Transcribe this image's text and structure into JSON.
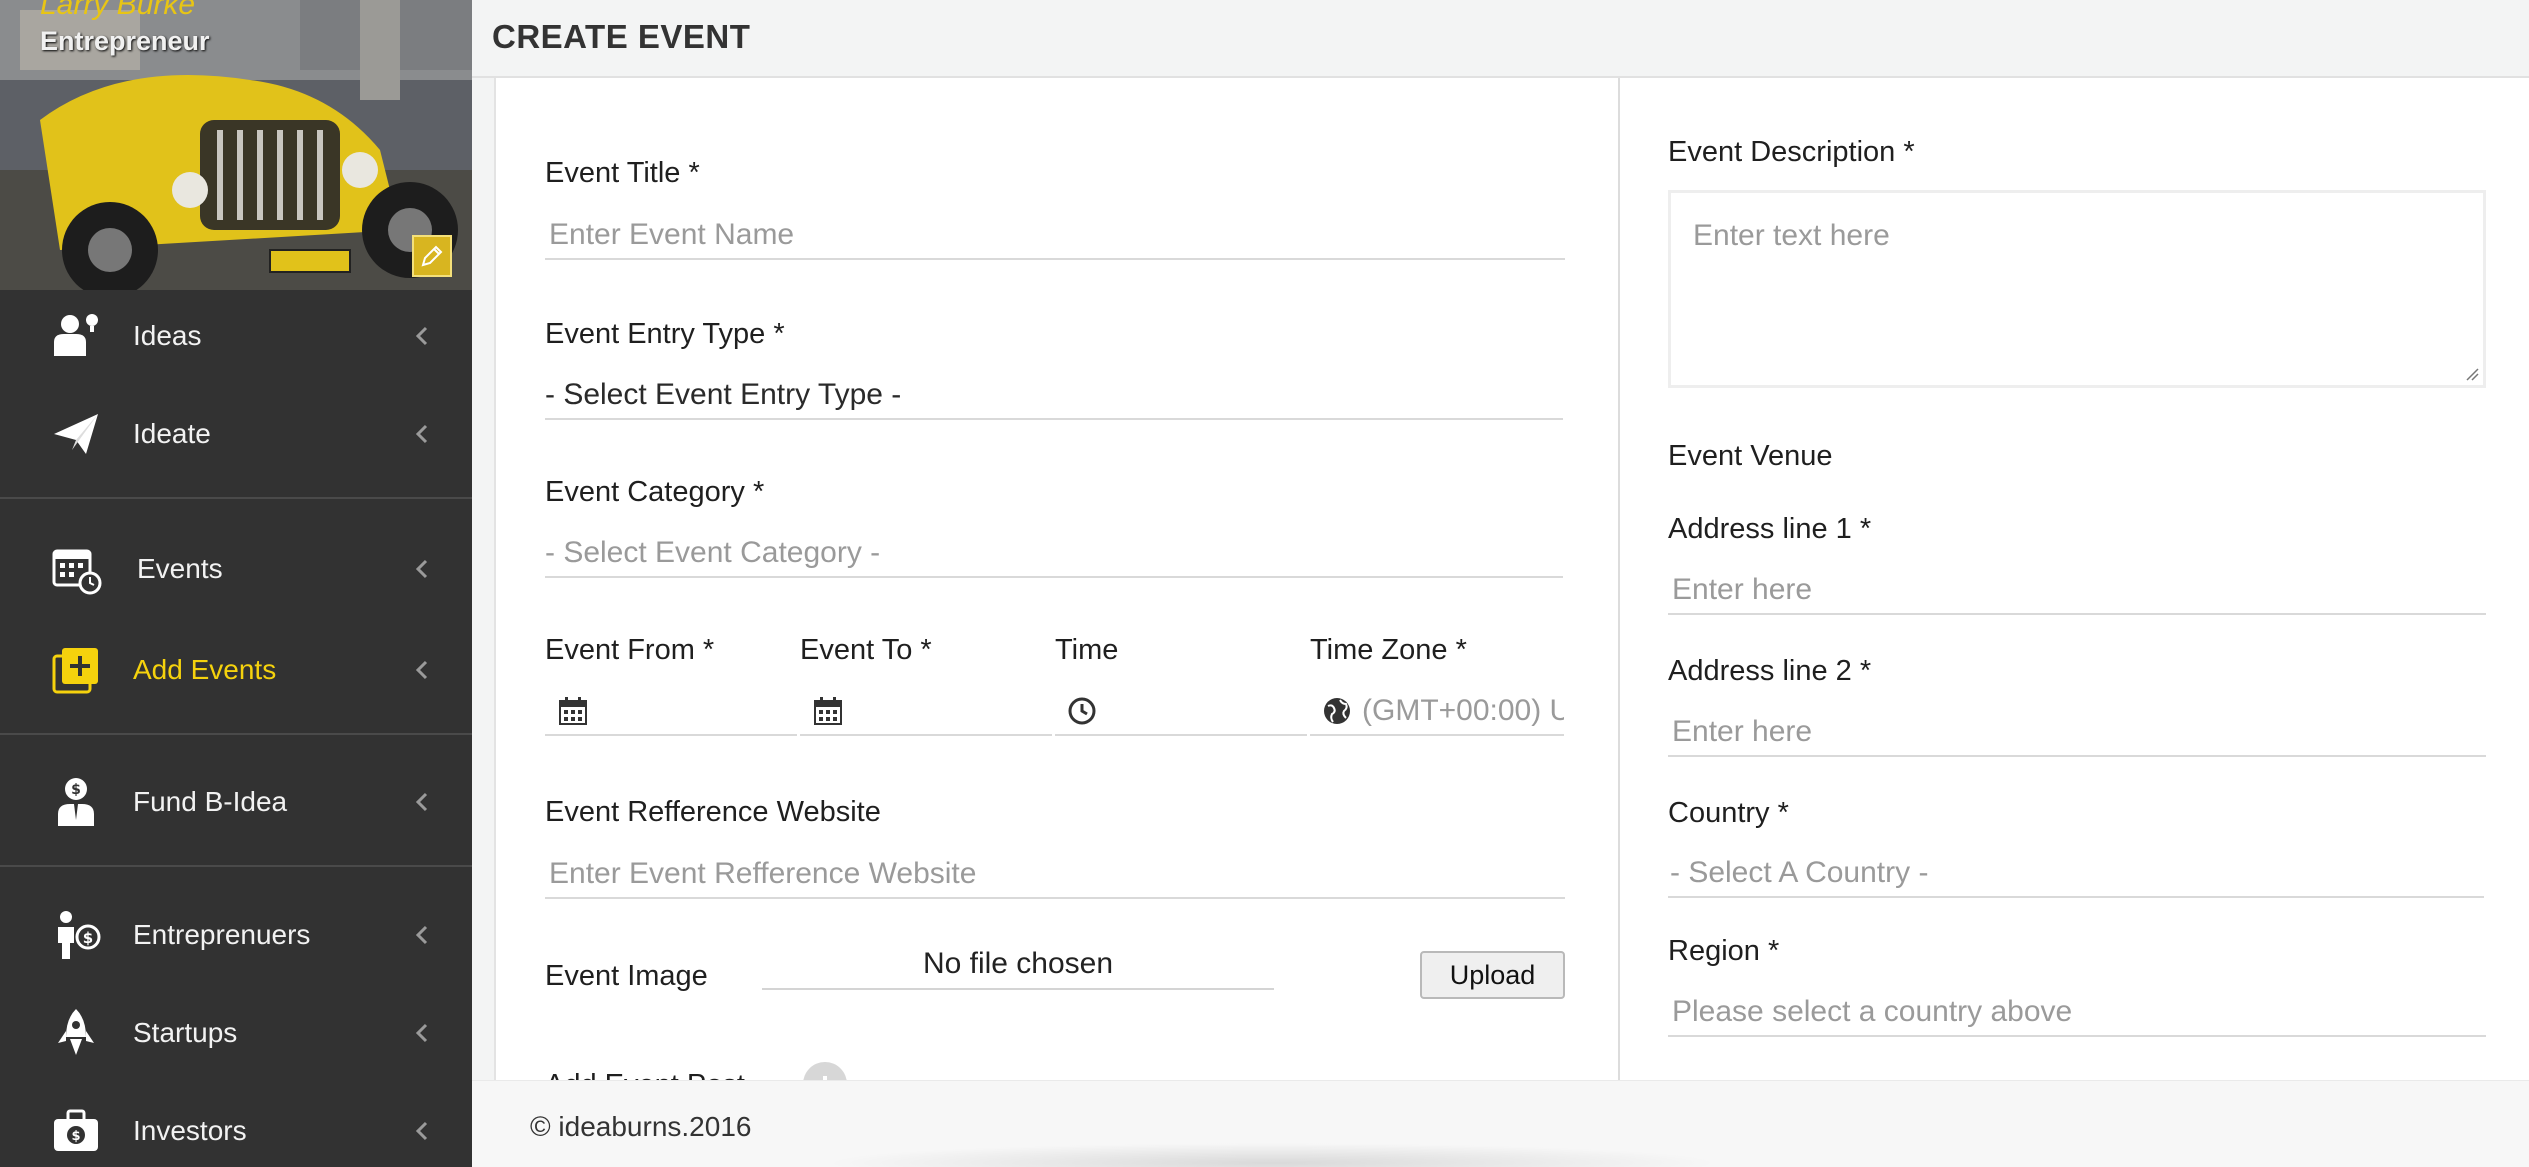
{
  "profile": {
    "name": "Larry Burke",
    "role": "Entrepreneur"
  },
  "nav": [
    {
      "label": "Ideas",
      "icon": "idea-user-icon"
    },
    {
      "label": "Ideate",
      "icon": "paper-plane-icon"
    },
    {
      "label": "Events",
      "icon": "calendar-clock-icon"
    },
    {
      "label": "Add Events",
      "icon": "plus-square-icon",
      "active": true
    },
    {
      "label": "Fund B-Idea",
      "icon": "businessman-dollar-icon"
    },
    {
      "label": "Entreprenuers",
      "icon": "person-dollar-icon"
    },
    {
      "label": "Startups",
      "icon": "rocket-icon"
    },
    {
      "label": "Investors",
      "icon": "briefcase-icon"
    }
  ],
  "page_title": "CREATE EVENT",
  "form": {
    "title_label": "Event Title *",
    "title_placeholder": "Enter Event Name",
    "entry_type_label": "Event Entry Type *",
    "entry_type_value": "- Select Event Entry Type -",
    "category_label": "Event Category *",
    "category_value": "- Select Event Category -",
    "from_label": "Event From *",
    "to_label": "Event To *",
    "time_label": "Time",
    "timezone_label": "Time Zone *",
    "timezone_value": "(GMT+00:00) U",
    "website_label": "Event Refference Website",
    "website_placeholder": "Enter Event Refference Website",
    "image_label": "Event Image",
    "file_status": "No file chosen",
    "upload_label": "Upload",
    "add_more_label": "Add Event Post"
  },
  "right_form": {
    "description_label": "Event Description *",
    "description_placeholder": "Enter text here",
    "venue_heading": "Event Venue",
    "address1_label": "Address line 1 *",
    "address1_placeholder": "Enter here",
    "address2_label": "Address line 2 *",
    "address2_placeholder": "Enter here",
    "country_label": "Country *",
    "country_value": "- Select A Country -",
    "region_label": "Region *",
    "region_value": "Please select a country above"
  },
  "footer": {
    "copyright": "© ideaburns.2016"
  },
  "colors": {
    "sidebar_bg": "#323232",
    "accent": "#f5d20d",
    "active_label": "#f5d20d"
  }
}
